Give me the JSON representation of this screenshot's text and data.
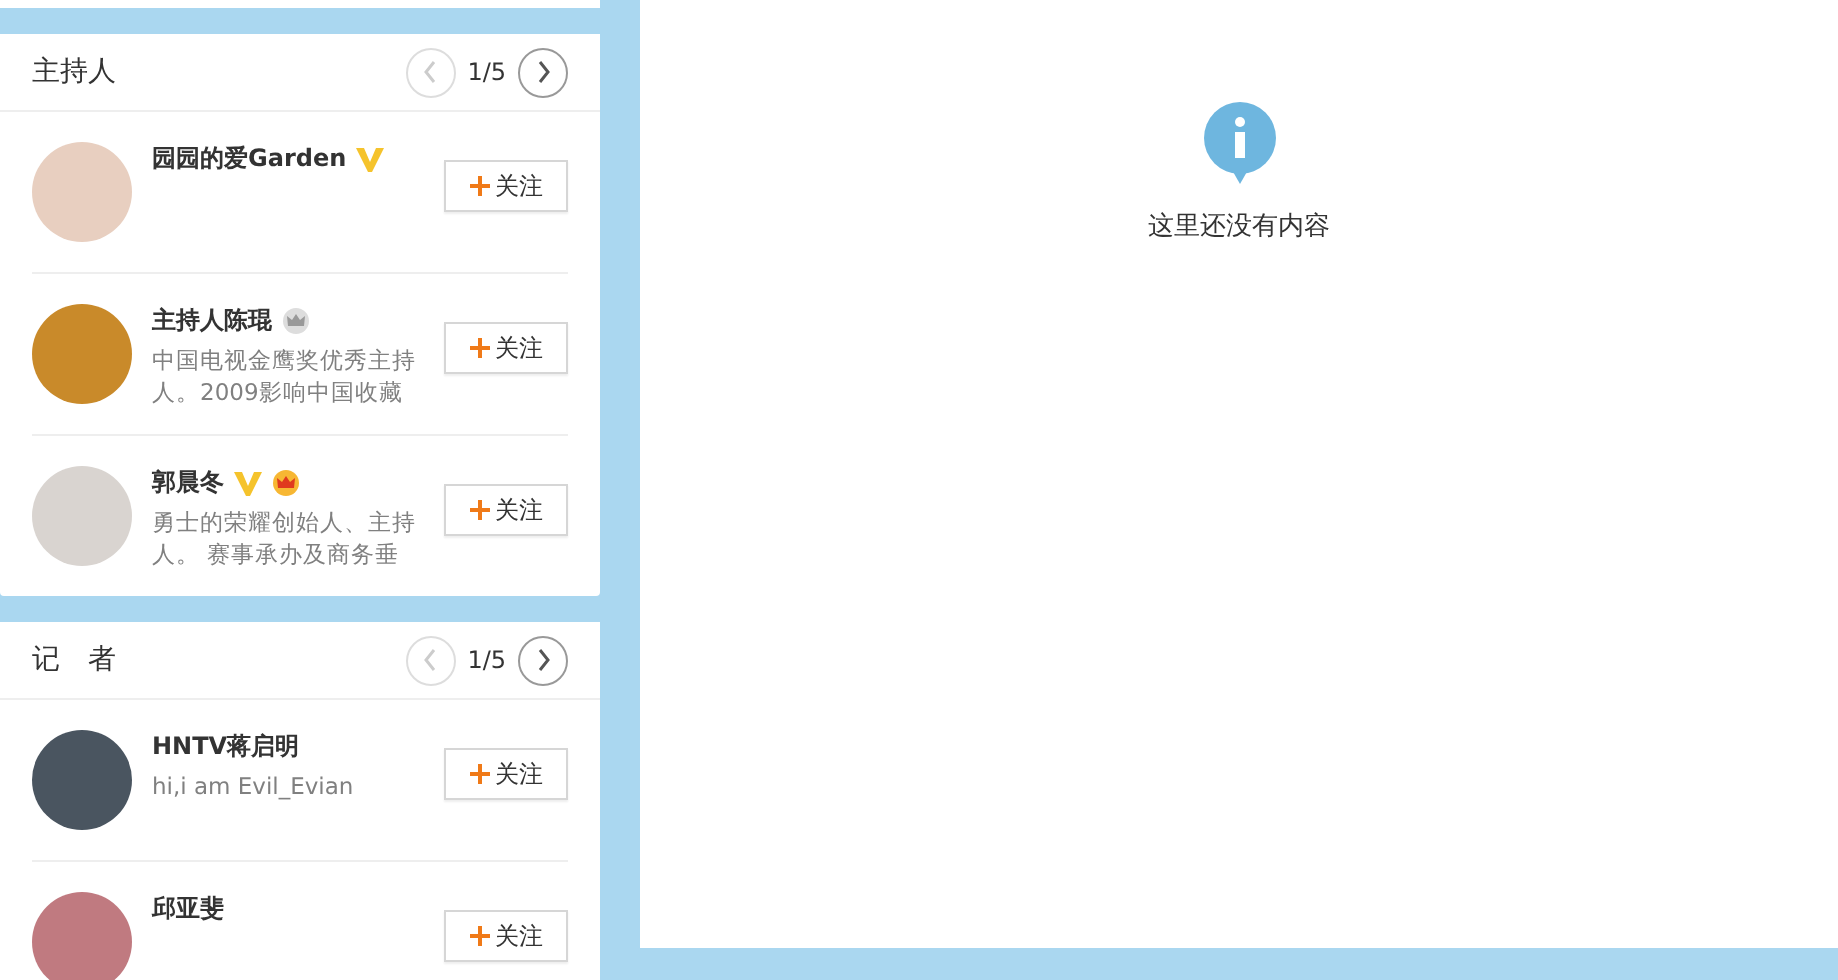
{
  "sections": [
    {
      "title": "主持人",
      "page": "1/5",
      "users": [
        {
          "name": "园园的爱Garden",
          "verified": true,
          "crown": false,
          "follow": "关注"
        },
        {
          "name": "主持人陈琨",
          "verified": false,
          "crown": true,
          "crown_gold": false,
          "bio": "中国电视金鹰奖优秀主持人。2009影响中国收藏",
          "follow": "关注"
        },
        {
          "name": "郭晨冬",
          "verified": true,
          "crown": true,
          "crown_gold": true,
          "bio": "勇士的荣耀创始人、主持人。 赛事承办及商务垂",
          "follow": "关注"
        }
      ]
    },
    {
      "title": "记　者",
      "page": "1/5",
      "users": [
        {
          "name": "HNTV蒋启明",
          "verified": false,
          "crown": false,
          "bio": "hi,i am Evil_Evian",
          "follow": "关注"
        },
        {
          "name": "邱亚斐",
          "verified": false,
          "crown": false,
          "follow": "关注"
        }
      ]
    }
  ],
  "empty": {
    "message": "这里还没有内容"
  }
}
